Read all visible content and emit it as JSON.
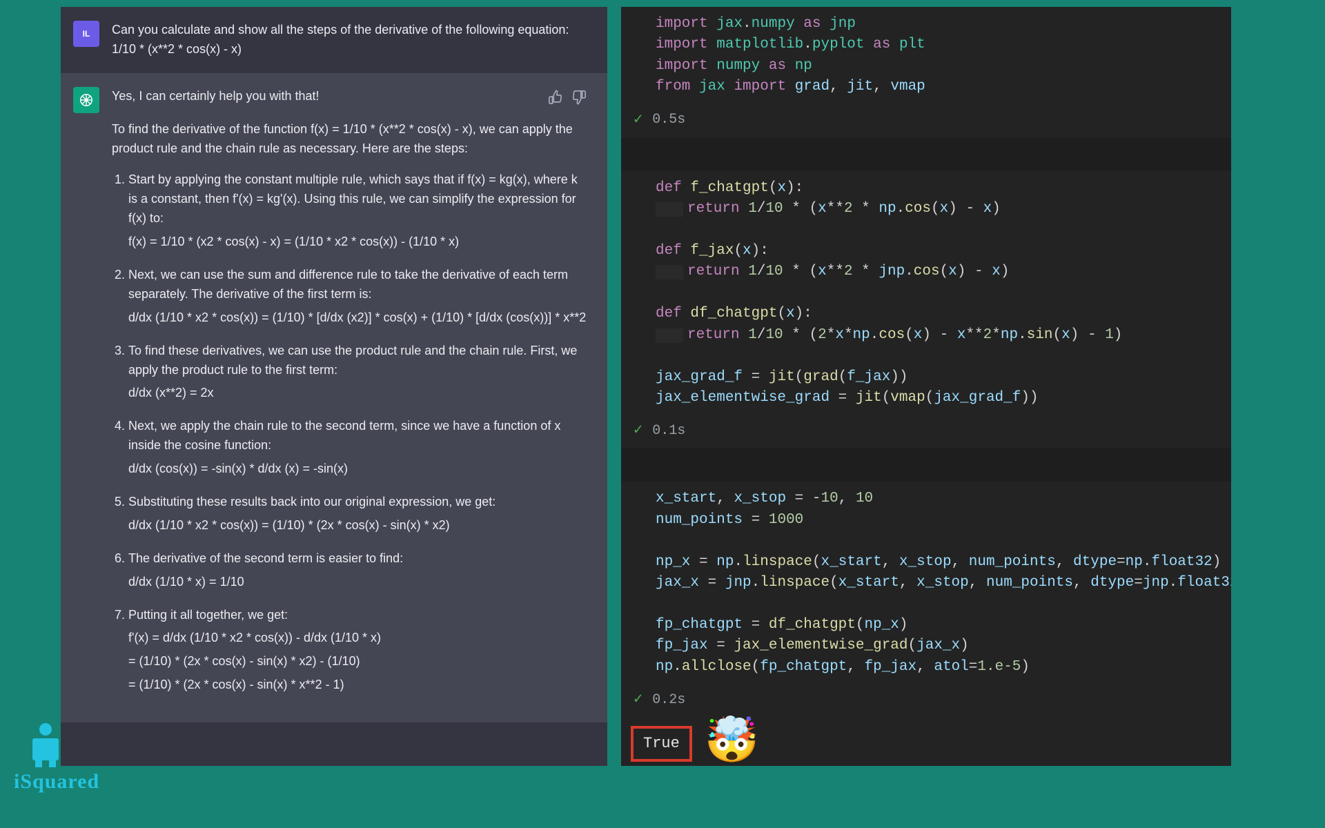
{
  "chat": {
    "user_initials": "IL",
    "user_message": "Can you calculate and show all the steps of the derivative of the following equation: 1/10 * (x**2 * cos(x) - x)",
    "assistant_lead": "Yes, I can certainly help you with that!",
    "assistant_intro": "To find the derivative of the function f(x) = 1/10 * (x**2 * cos(x) - x), we can apply the product rule and the chain rule as necessary. Here are the steps:",
    "steps": [
      "Start by applying the constant multiple rule, which says that if f(x) = kg(x), where k is a constant, then f'(x) = kg'(x). Using this rule, we can simplify the expression for f(x) to:",
      "Next, we can use the sum and difference rule to take the derivative of each term separately. The derivative of the first term is:",
      "To find these derivatives, we can use the product rule and the chain rule. First, we apply the product rule to the first term:",
      "Next, we apply the chain rule to the second term, since we have a function of x inside the cosine function:",
      "Substituting these results back into our original expression, we get:",
      "The derivative of the second term is easier to find:",
      "Putting it all together, we get:"
    ],
    "formulas": {
      "after1": "f(x) = 1/10 * (x2 * cos(x) - x) = (1/10 * x2 * cos(x)) - (1/10 * x)",
      "after2": "d/dx (1/10 * x2 * cos(x)) = (1/10) * [d/dx (x2)] * cos(x) + (1/10) * [d/dx (cos(x))] * x**2",
      "after3": "d/dx (x**2) = 2x",
      "after4": "d/dx (cos(x)) = -sin(x) * d/dx (x) = -sin(x)",
      "after5": "d/dx (1/10 * x2 * cos(x)) = (1/10) * (2x * cos(x) - sin(x) * x2)",
      "after6": "d/dx (1/10 * x) = 1/10",
      "final1": "f'(x) = d/dx (1/10 * x2 * cos(x)) - d/dx (1/10 * x)",
      "final2": "= (1/10) * (2x * cos(x) - sin(x) * x2) - (1/10)",
      "final3": "= (1/10) * (2x * cos(x) - sin(x) * x**2 - 1)"
    },
    "thumbs_up": "👍",
    "thumbs_down": "👎"
  },
  "notebook": {
    "cell1_time": "0.5s",
    "cell2_time": "0.1s",
    "cell3_time": "0.2s",
    "output_true": "True",
    "emoji": "🤯"
  },
  "logo_text": "iSquared"
}
